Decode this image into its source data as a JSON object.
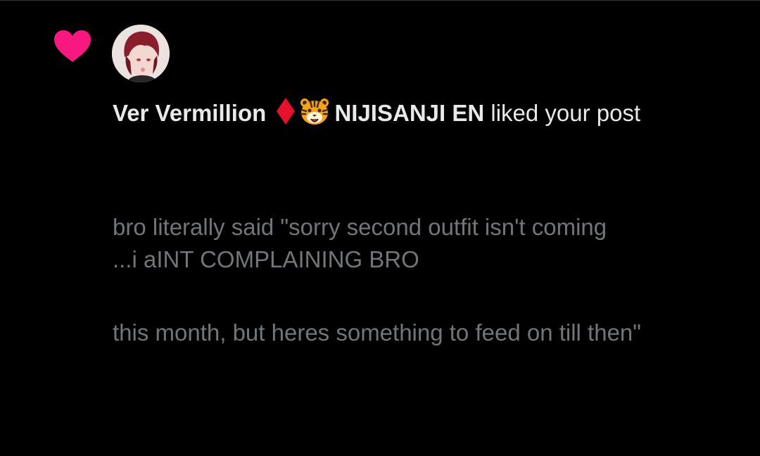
{
  "notification": {
    "type": "like",
    "user_name": "Ver Vermillion",
    "user_org": "NIJISANJI EN",
    "action_text": "liked your post",
    "post_lines": [
      "bro literally said \"sorry second outfit isn't coming",
      "this month, but heres something to feed on till then\"",
      "...i aINT COMPLAINING BRO"
    ]
  },
  "icons": {
    "heart": "heart-icon",
    "diamond": "red-diamond-icon",
    "tiger": "tiger-face-icon"
  },
  "colors": {
    "background": "#000000",
    "heart": "#f91880",
    "primary_text": "#e7e9ea",
    "secondary_text": "#71767b",
    "diamond": "#e8112d"
  }
}
